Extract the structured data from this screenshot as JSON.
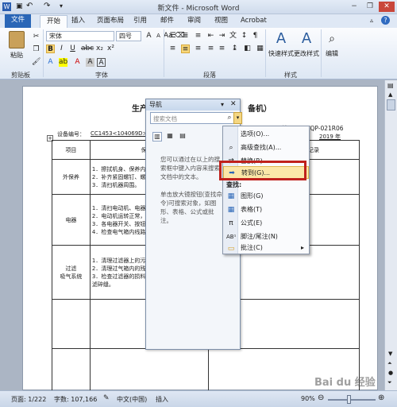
{
  "window": {
    "title": "新文件 - Microsoft Word"
  },
  "tabs": [
    "文件",
    "开始",
    "插入",
    "页面布局",
    "引用",
    "邮件",
    "审阅",
    "视图",
    "Acrobat"
  ],
  "ribbon": {
    "paste": "粘贴",
    "clipboard": "剪贴板",
    "font_name": "宋体",
    "font_size": "四号",
    "font_group": "字体",
    "paragraph_group": "段落",
    "styles": "快速样式",
    "change_styles": "更改样式",
    "style_group": "样式",
    "edit": "编辑",
    "bold": "B",
    "italic": "I",
    "underline": "U"
  },
  "document": {
    "title_left": "生产",
    "title_right": "备机）",
    "device_label": "设备编号：",
    "device_value": "CC1453<104069D>",
    "doc_code": "编号：CC/QP-021R06",
    "year": "2019 年",
    "headers": [
      "项目",
      "保养内",
      "记录"
    ],
    "rows": [
      {
        "item": "外保养",
        "content": "1．擦拭机身、保养内\n2．补齐紧固螺钉、螺\n3．清扫机器周围。"
      },
      {
        "item": "电器",
        "content": "1．清扫电动机、电器\n2．电动机运转正常，\n3．各电器开关、按钮\n4．检查电气箱内线路"
      },
      {
        "item": "过滤\n吸气系统",
        "content": "1．清理过滤器上的污\n2．清理过气箱内的残\n3．检查过滤器的损料\n滤碎缝。"
      }
    ]
  },
  "nav": {
    "title": "导航",
    "search_placeholder": "搜索文档",
    "hint1": "您可以通过在以上的搜索框中键入内容来搜索文档中的文本。",
    "hint2": "单击放大镜按钮(查找命令)可搜索对象，如图形、表格、公式或批注。"
  },
  "menu": {
    "items": [
      "选项(O)...",
      "高级查找(A)...",
      "替换(R)...",
      "转到(G)..."
    ],
    "section": "查找:",
    "find_items": [
      "图形(G)",
      "表格(T)",
      "公式(E)",
      "脚注/尾注(N)",
      "批注(C)"
    ]
  },
  "status": {
    "page": "页面: 1/222",
    "words": "字数: 107,166",
    "lang": "中文(中国)",
    "insert": "插入",
    "zoom": "90%"
  },
  "watermark": "Bai du 经验"
}
